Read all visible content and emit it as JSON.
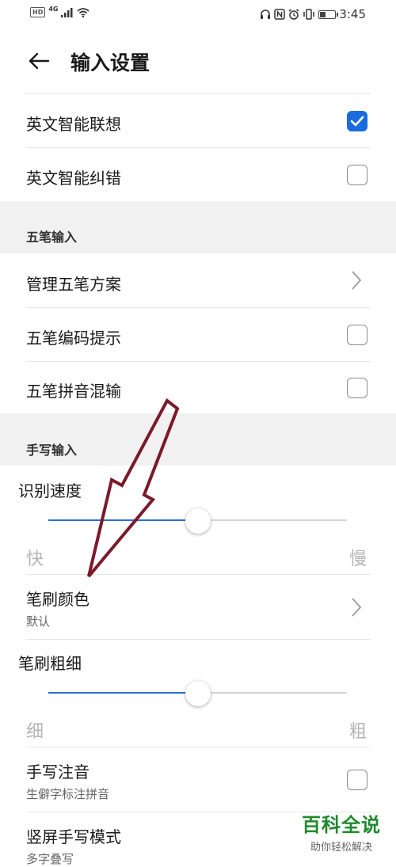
{
  "status_bar": {
    "left_badge": "HD",
    "network": "4G",
    "time": "3:45"
  },
  "header": {
    "title": "输入设置"
  },
  "rows_top": [
    {
      "label": "英文智能联想",
      "checked": true
    },
    {
      "label": "英文智能纠错",
      "checked": false
    }
  ],
  "section_wubi": {
    "label": "五笔输入",
    "items": [
      {
        "label": "管理五笔方案"
      },
      {
        "label": "五笔编码提示",
        "checked": false
      },
      {
        "label": "五笔拼音混输",
        "checked": false
      }
    ]
  },
  "section_handwriting": {
    "label": "手写输入",
    "speed": {
      "title": "识别速度",
      "min_label": "快",
      "max_label": "慢",
      "value_fraction": 0.5
    },
    "brush_color": {
      "label": "笔刷颜色",
      "value": "默认"
    },
    "brush_width": {
      "title": "笔刷粗细",
      "min_label": "细",
      "max_label": "粗",
      "value_fraction": 0.5
    },
    "phonetic": {
      "label": "手写注音",
      "sub": "生僻字标注拼音",
      "checked": false
    },
    "vertical_mode": {
      "label": "竖屏手写模式",
      "sub": "多字叠写"
    }
  },
  "watermark": {
    "main": "百科全说",
    "sub": "助你轻松解决"
  },
  "colors": {
    "accent": "#1a6cde",
    "annotation_arrow": "#7a1a2a",
    "watermark": "#1f8a2c"
  }
}
